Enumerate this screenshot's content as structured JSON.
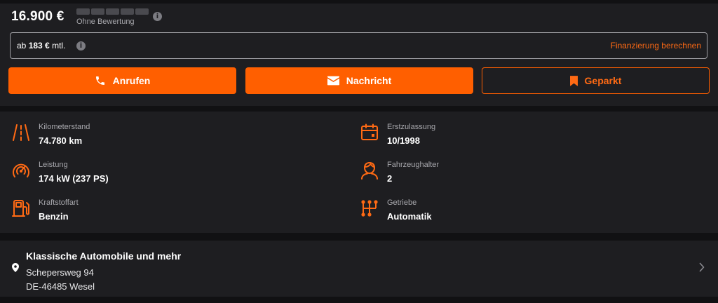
{
  "header": {
    "price": "16.900 €",
    "rating_text": "Ohne Bewertung",
    "rating_icon": "info-icon"
  },
  "finance": {
    "prefix": "ab",
    "amount": "183 €",
    "suffix": "mtl.",
    "link_label": "Finanzierung berechnen"
  },
  "actions": {
    "call_label": "Anrufen",
    "message_label": "Nachricht",
    "park_label": "Geparkt"
  },
  "specs": {
    "mileage": {
      "label": "Kilometerstand",
      "value": "74.780 km",
      "icon": "road-icon"
    },
    "power": {
      "label": "Leistung",
      "value": "174 kW (237 PS)",
      "icon": "speedometer-icon"
    },
    "fuel": {
      "label": "Kraftstoffart",
      "value": "Benzin",
      "icon": "fuel-pump-icon"
    },
    "registration": {
      "label": "Erstzulassung",
      "value": "10/1998",
      "icon": "calendar-icon"
    },
    "owners": {
      "label": "Fahrzeughalter",
      "value": "2",
      "icon": "person-icon"
    },
    "transmission": {
      "label": "Getriebe",
      "value": "Automatik",
      "icon": "gearshift-icon"
    }
  },
  "dealer": {
    "name": "Klassische Automobile und mehr",
    "street": "Schepersweg 94",
    "city": "DE-46485 Wesel"
  },
  "colors": {
    "accent": "#ff5f00",
    "panel": "#1e1e21",
    "background": "#111113",
    "muted_text": "#a9a9ae"
  }
}
